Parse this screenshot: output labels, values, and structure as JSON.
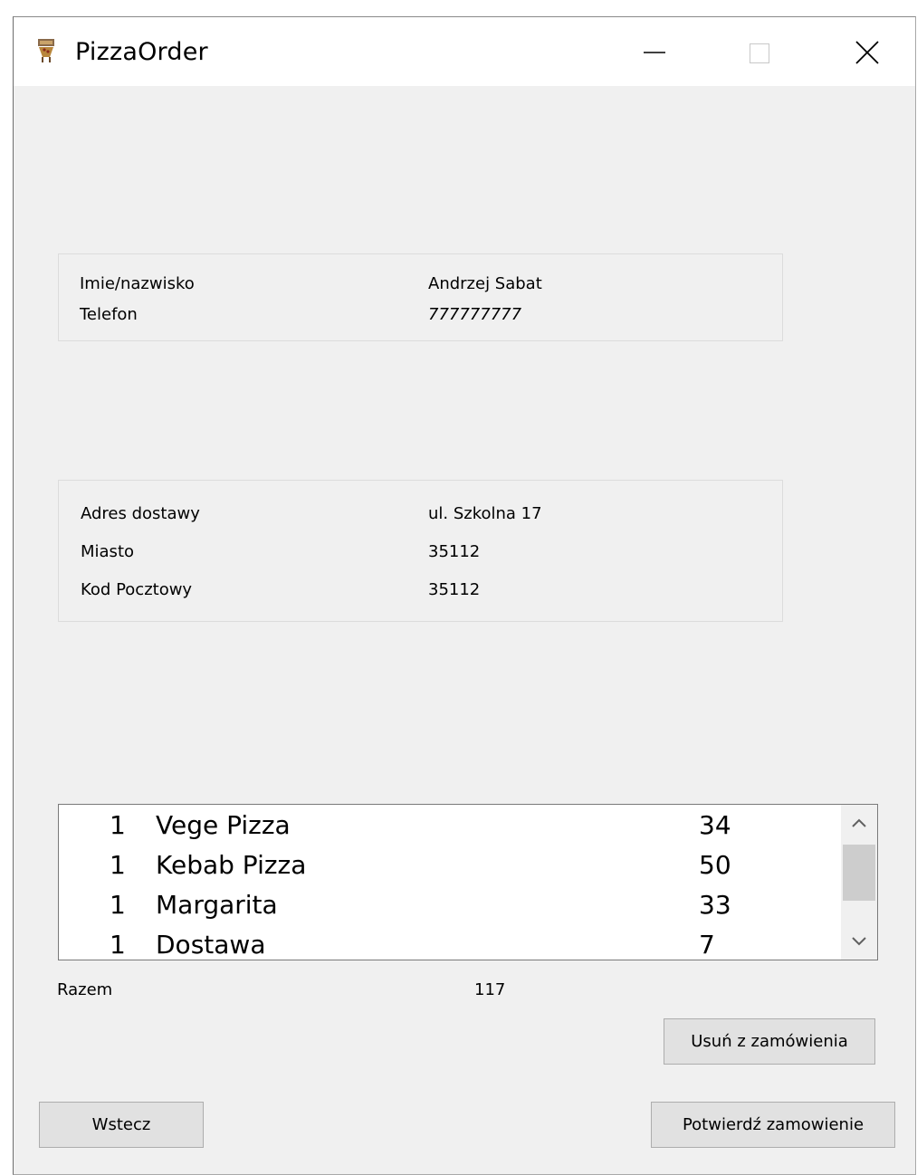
{
  "window": {
    "title": "PizzaOrder"
  },
  "customer": {
    "name_label": "Imie/nazwisko",
    "name_value": "Andrzej Sabat",
    "phone_label": "Telefon",
    "phone_value": "777777777"
  },
  "address": {
    "street_label": "Adres dostawy",
    "street_value": "ul. Szkolna 17",
    "city_label": "Miasto",
    "city_value": "35112",
    "postal_label": "Kod Pocztowy",
    "postal_value": "35112"
  },
  "order": {
    "items": [
      {
        "qty": "1",
        "name": "Vege Pizza",
        "price": "34"
      },
      {
        "qty": "1",
        "name": "Kebab Pizza",
        "price": "50"
      },
      {
        "qty": "1",
        "name": "Margarita",
        "price": "33"
      },
      {
        "qty": "1",
        "name": "Dostawa",
        "price": "7"
      }
    ],
    "total_label": "Razem",
    "total_value": "117"
  },
  "buttons": {
    "remove_label": "Usuń z zamówienia",
    "back_label": "Wstecz",
    "confirm_label": "Potwierdź zamowienie"
  },
  "icons": {
    "app": "pizza-icon",
    "minimize": "minimize-icon",
    "maximize": "maximize-icon",
    "close": "close-icon",
    "scroll_up": "chevron-up-icon",
    "scroll_down": "chevron-down-icon"
  }
}
